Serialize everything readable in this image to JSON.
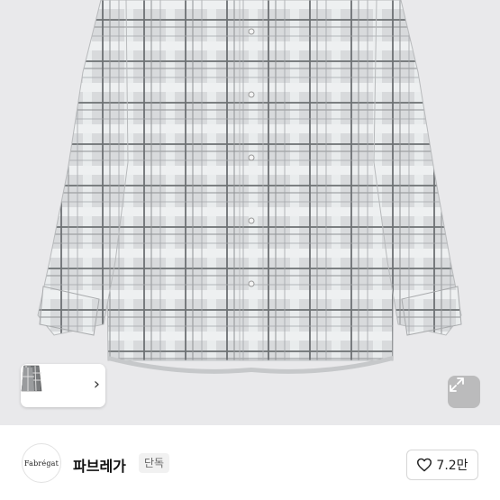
{
  "product": {
    "image_alt": "gray plaid long-sleeve shirt",
    "thumbnails": [
      "shirt-front-thumb",
      "shirt-side-thumb",
      "shirt-back-thumb"
    ],
    "thumb_chevron": "›",
    "expand_icon": "expand-icon"
  },
  "brand": {
    "logo_text": "Fabrégat",
    "name": "파브레가",
    "badge": "단독"
  },
  "like": {
    "icon": "heart-icon",
    "count": "7.2만"
  },
  "colors": {
    "background": "#e9e9eb",
    "shirt": "#d4d6d8",
    "check_dark": "#6e7174",
    "check_light": "#ffffff"
  }
}
